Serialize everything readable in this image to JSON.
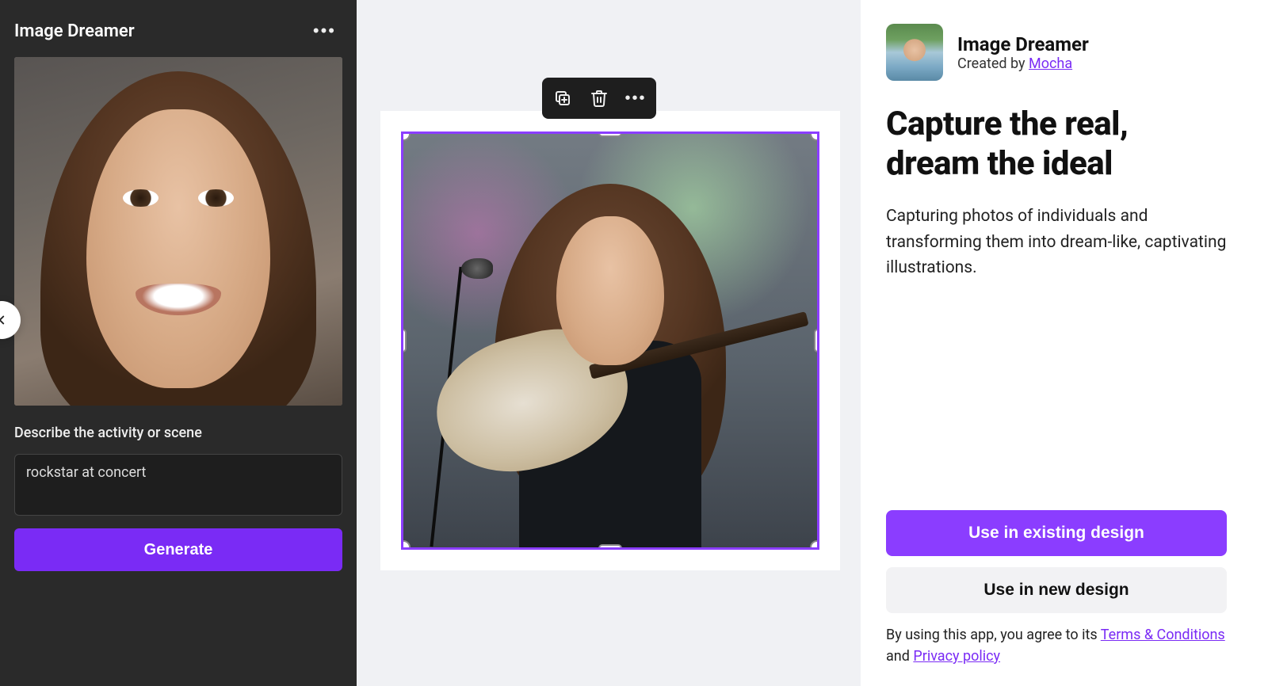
{
  "panel": {
    "title": "Image Dreamer",
    "prompt_label": "Describe the activity or scene",
    "prompt_value": "rockstar at concert",
    "generate_label": "Generate"
  },
  "app": {
    "name": "Image Dreamer",
    "created_by_prefix": "Created by ",
    "creator": "Mocha",
    "headline": "Capture the real, dream the ideal",
    "description": "Capturing photos of individuals and transforming them into dream-like, captivating illustrations.",
    "use_existing": "Use in existing design",
    "use_new": "Use in new design",
    "legal_prefix": "By using this app, you agree to its ",
    "terms": "Terms & Conditions",
    "legal_and": " and ",
    "privacy": "Privacy policy"
  },
  "colors": {
    "accent": "#8b3dff",
    "panel_bg": "#2a2a2a"
  }
}
